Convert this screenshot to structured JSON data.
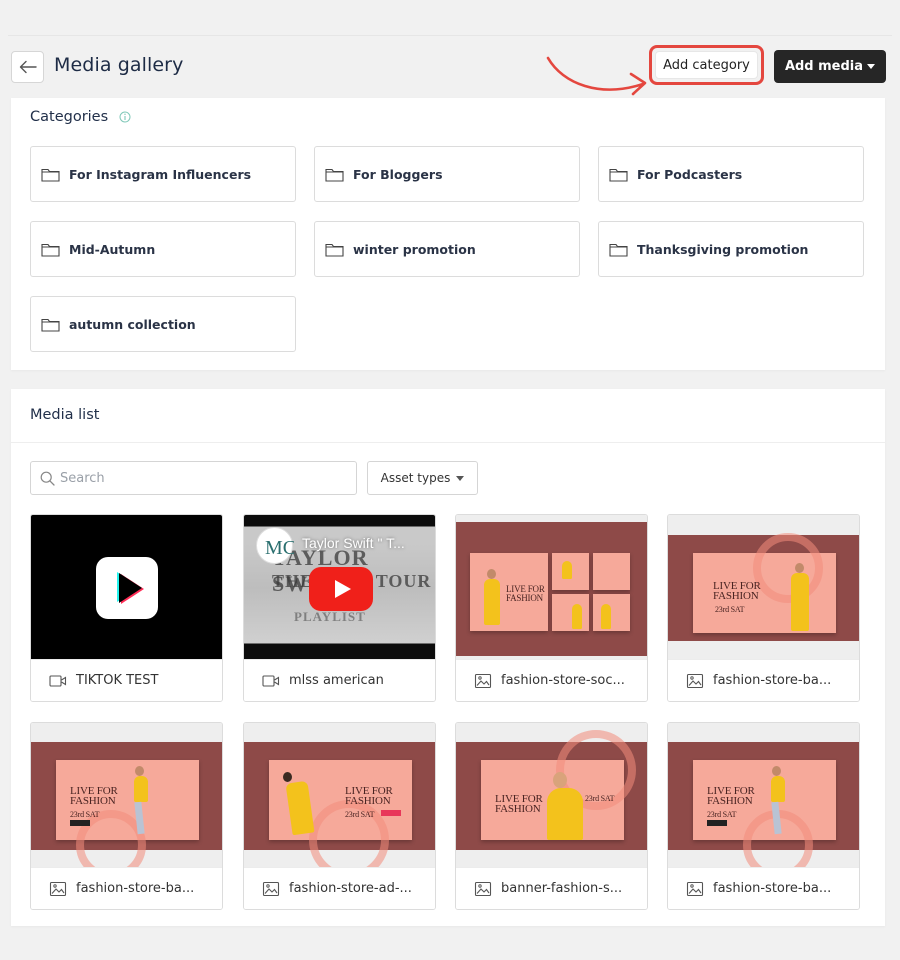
{
  "header": {
    "title": "Media gallery",
    "back_icon": "arrow-left-icon",
    "add_category_label": "Add category",
    "add_media_label": "Add media",
    "annotation_color": "#e4473f"
  },
  "categories": {
    "title": "Categories",
    "info_icon": "info-icon",
    "items": [
      {
        "label": "For Instagram Influencers"
      },
      {
        "label": "For Bloggers"
      },
      {
        "label": "For Podcasters"
      },
      {
        "label": "Mid-Autumn"
      },
      {
        "label": "winter promotion"
      },
      {
        "label": "Thanksgiving promotion"
      },
      {
        "label": "autumn collection"
      }
    ]
  },
  "media_list": {
    "title": "Media list",
    "search": {
      "placeholder": "Search",
      "value": ""
    },
    "asset_types_label": "Asset types",
    "items": [
      {
        "name": "TIKTOK TEST",
        "type": "video",
        "thumb": "tiktok"
      },
      {
        "name": "mlss american",
        "type": "video",
        "thumb": "youtube",
        "thumb_title": "Taylor Swift \" T...",
        "thumb_text": [
          "TAYLOR SWIFT",
          "THE ERAS TOUR",
          "PLAYLIST"
        ]
      },
      {
        "name": "fashion-store-soc...",
        "type": "image",
        "thumb": "fashion-social",
        "thumb_text": [
          "LIVE FOR",
          "FASHION"
        ]
      },
      {
        "name": "fashion-store-ba...",
        "type": "image",
        "thumb": "fashion-banner",
        "thumb_text": [
          "LIVE FOR",
          "FASHION",
          "23rd SAT"
        ]
      },
      {
        "name": "fashion-store-ba...",
        "type": "image",
        "thumb": "fashion-banner",
        "thumb_text": [
          "LIVE FOR",
          "FASHION",
          "23rd SAT"
        ]
      },
      {
        "name": "fashion-store-ad-...",
        "type": "image",
        "thumb": "fashion-banner",
        "thumb_text": [
          "LIVE FOR",
          "FASHION",
          "23rd SAT"
        ]
      },
      {
        "name": "banner-fashion-s...",
        "type": "image",
        "thumb": "fashion-banner",
        "thumb_text": [
          "LIVE FOR",
          "FASHION",
          "23rd SAT"
        ]
      },
      {
        "name": "fashion-store-ba...",
        "type": "image",
        "thumb": "fashion-banner",
        "thumb_text": [
          "LIVE FOR",
          "FASHION",
          "23rd SAT"
        ]
      }
    ]
  }
}
